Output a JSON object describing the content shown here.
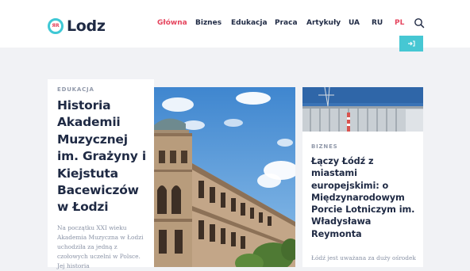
{
  "header": {
    "logo_badge": "ЯR",
    "logo_text": "Lodz",
    "nav": [
      {
        "label": "Główna",
        "active": true
      },
      {
        "label": "Biznes",
        "active": false
      },
      {
        "label": "Edukacja",
        "active": false
      },
      {
        "label": "Praca",
        "active": false
      },
      {
        "label": "Artykuły",
        "active": false
      }
    ],
    "languages": [
      {
        "label": "UA",
        "active": false
      },
      {
        "label": "RU",
        "active": false
      },
      {
        "label": "PL",
        "active": true
      }
    ],
    "search_icon": "search-icon",
    "login_icon": "sign-in-icon"
  },
  "articles": {
    "featured": {
      "category": "EDUKACJA",
      "title": "Historia Akademii Muzycznej im. Grażyny i Kiejstuta Bacewiczów w Łodzi",
      "excerpt": "Na początku XXI wieku Akademia Muzyczna w Łodzi uchodziła za jedną z czołowych uczelni w Polsce. Jej historia"
    },
    "second": {
      "category": "BIZNES",
      "title": "Łączy Łódź z miastami europejskimi: o Międzynarodowym Porcie Lotniczym im. Władysława Reymonta",
      "excerpt": "Łódź jest uważana za duży ośrodek"
    }
  },
  "colors": {
    "accent": "#e5455e",
    "brand": "#3fc8d5",
    "text": "#1f2a44",
    "muted": "#8a93a6"
  }
}
